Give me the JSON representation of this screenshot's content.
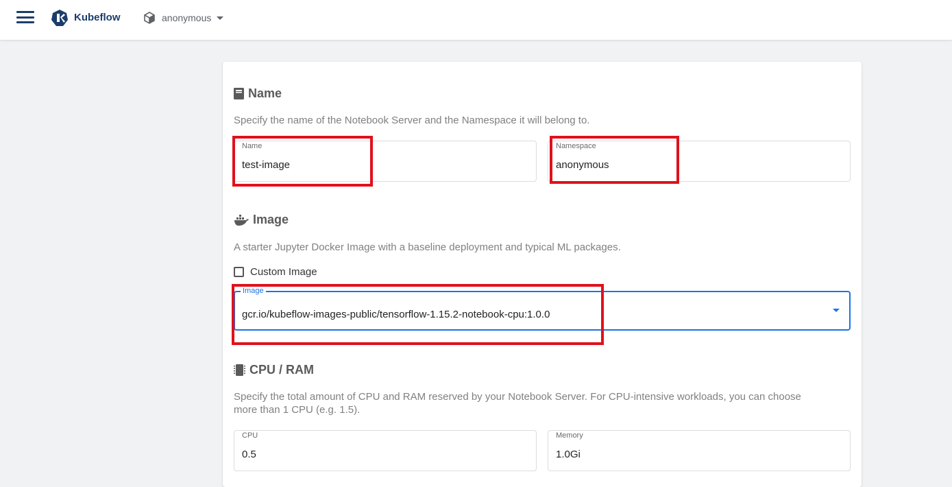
{
  "header": {
    "brand": "Kubeflow",
    "namespace": "anonymous"
  },
  "sections": {
    "name": {
      "title": "Name",
      "description": "Specify the name of the Notebook Server and the Namespace it will belong to.",
      "name_field": {
        "label": "Name",
        "value": "test-image"
      },
      "namespace_field": {
        "label": "Namespace",
        "value": "anonymous"
      }
    },
    "image": {
      "title": "Image",
      "description": "A starter Jupyter Docker Image with a baseline deployment and typical ML packages.",
      "custom_image_label": "Custom Image",
      "custom_image_checked": false,
      "image_field": {
        "label": "Image",
        "value": "gcr.io/kubeflow-images-public/tensorflow-1.15.2-notebook-cpu:1.0.0"
      }
    },
    "cpu_ram": {
      "title": "CPU / RAM",
      "description_line1": "Specify the total amount of CPU and RAM reserved by your Notebook Server. For CPU-intensive workloads, you can choose",
      "description_line2": "more than 1 CPU (e.g. 1.5).",
      "cpu_field": {
        "label": "CPU",
        "value": "0.5"
      },
      "memory_field": {
        "label": "Memory",
        "value": "1.0Gi"
      }
    }
  },
  "colors": {
    "brand": "#1b3d6b",
    "focus": "#1a73e8",
    "highlight": "#e0111c"
  }
}
